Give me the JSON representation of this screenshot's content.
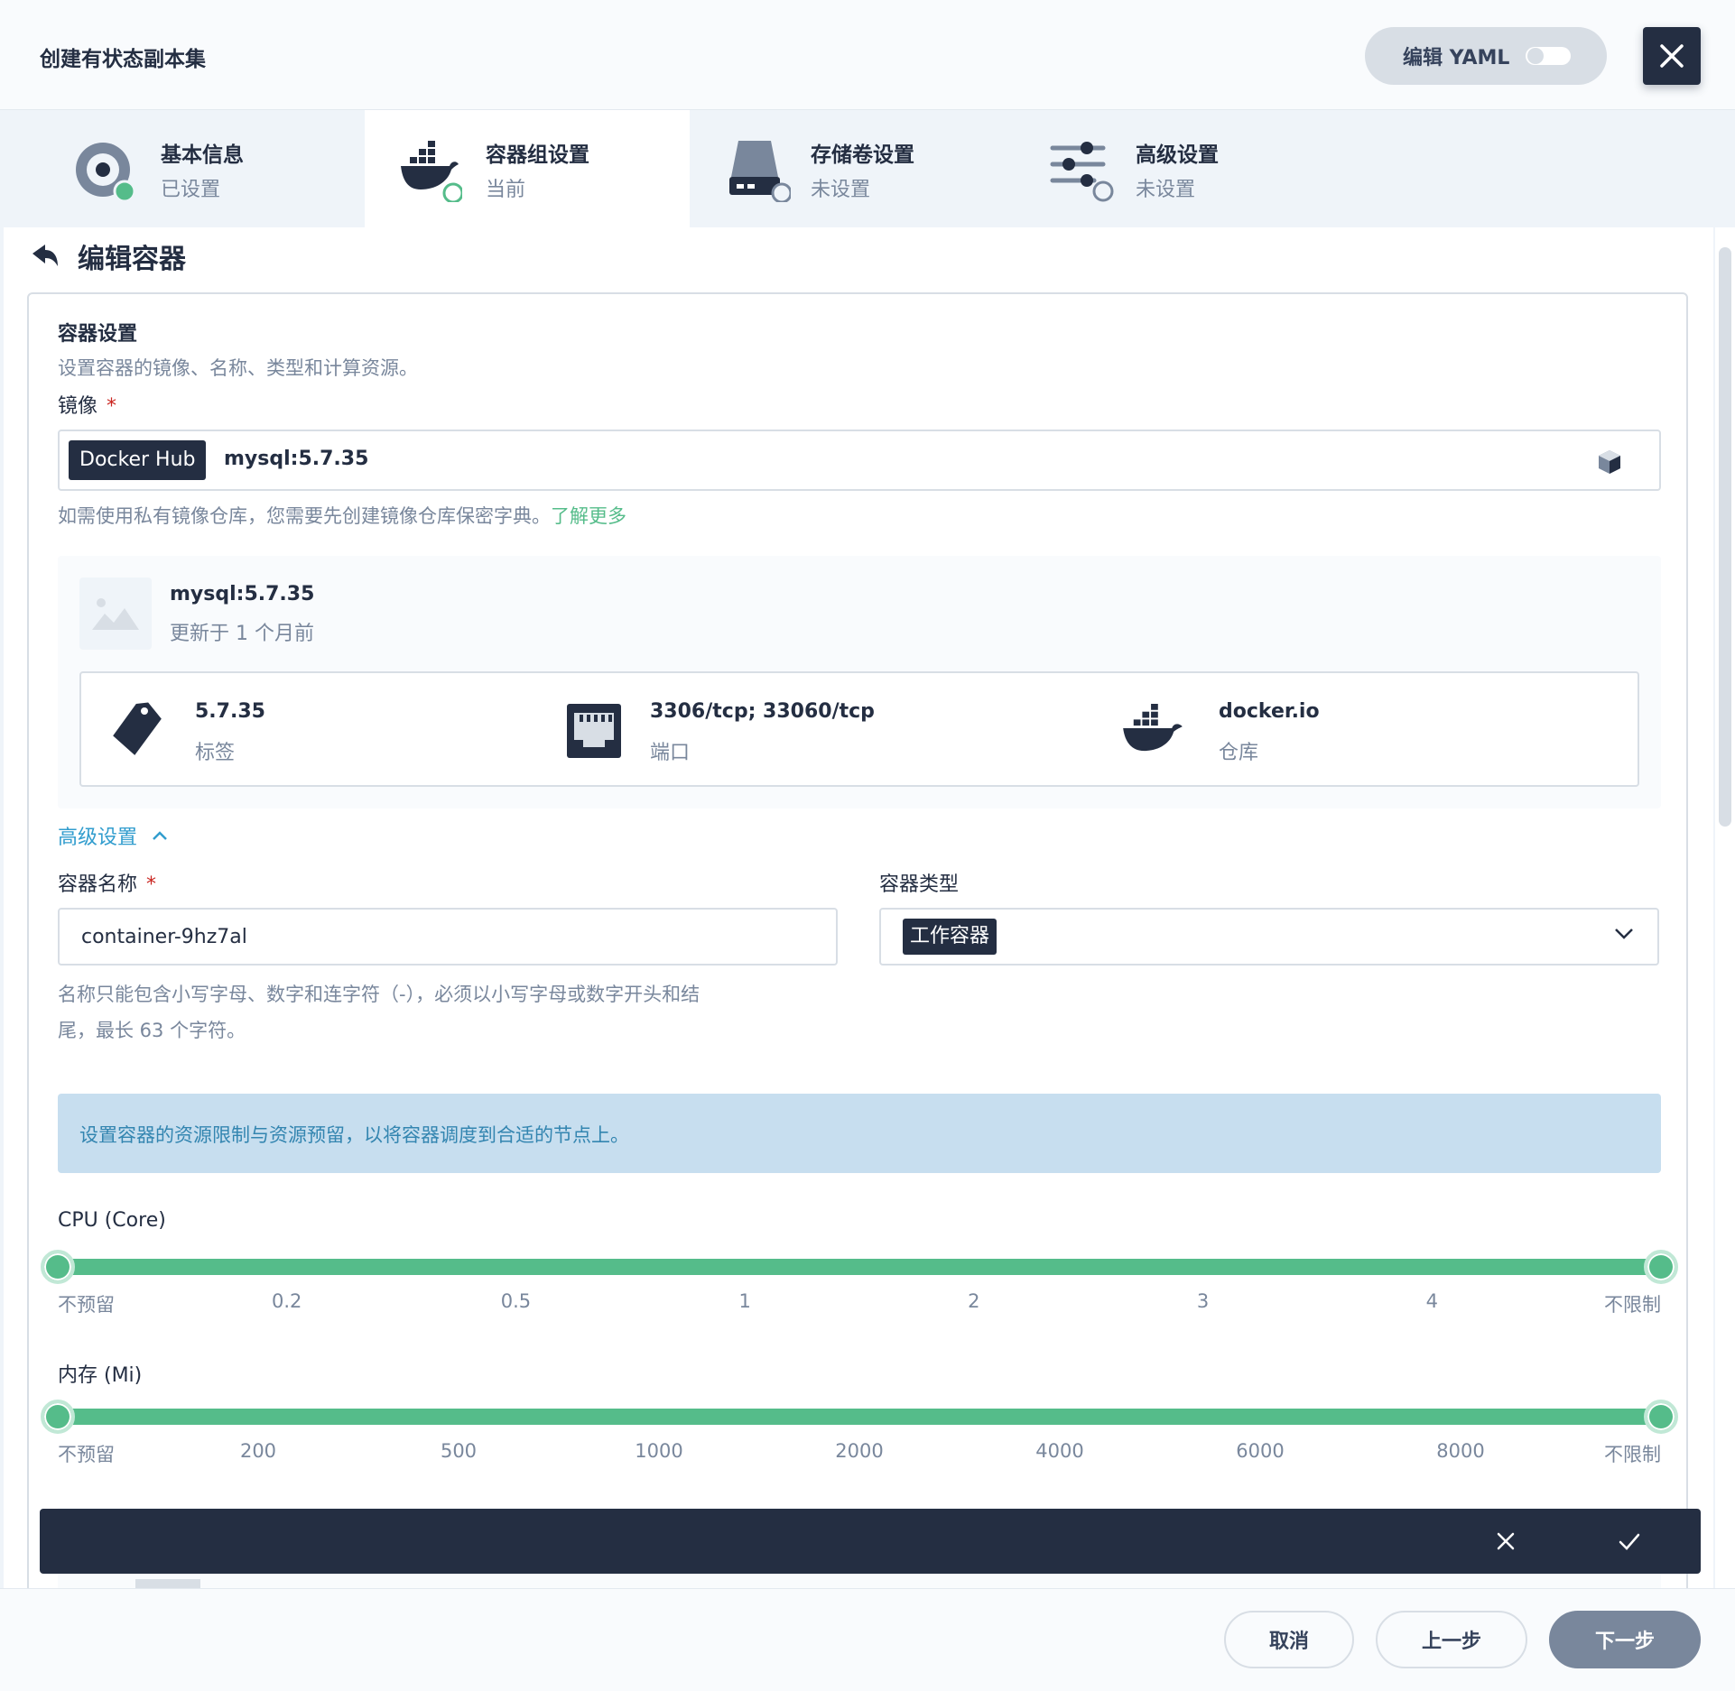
{
  "header": {
    "title": "创建有状态副本集",
    "yaml_label": "编辑 YAML"
  },
  "steps": [
    {
      "label": "基本信息",
      "status": "已设置"
    },
    {
      "label": "容器组设置",
      "status": "当前"
    },
    {
      "label": "存储卷设置",
      "status": "未设置"
    },
    {
      "label": "高级设置",
      "status": "未设置"
    }
  ],
  "editor": {
    "back_title": "编辑容器",
    "section_title": "容器设置",
    "section_desc": "设置容器的镜像、名称、类型和计算资源。",
    "image_label": "镜像",
    "required_mark": "*",
    "registry": "Docker Hub",
    "image_value": "mysql:5.7.35",
    "image_hint": "如需使用私有镜像仓库，您需要先创建镜像仓库保密字典。",
    "learn_more": "了解更多",
    "image_card": {
      "name": "mysql:5.7.35",
      "updated": "更新于 1 个月前",
      "tag_value": "5.7.35",
      "tag_label": "标签",
      "ports_value": "3306/tcp; 33060/tcp",
      "ports_label": "端口",
      "registry_value": "docker.io",
      "registry_label": "仓库"
    },
    "advanced_toggle": "高级设置",
    "name_label": "容器名称",
    "name_value": "container-9hz7al",
    "name_hint_1": "名称只能包含小写字母、数字和连字符（-），必须以小写字母或数字开头和结",
    "name_hint_2": "尾，最长 63 个字符。",
    "type_label": "容器类型",
    "type_value": "工作容器",
    "resource_info": "设置容器的资源限制与资源预留，以将容器调度到合适的节点上。",
    "cpu": {
      "label": "CPU (Core)",
      "ticks": [
        "不预留",
        "0.2",
        "0.5",
        "1",
        "2",
        "3",
        "4",
        "不限制"
      ],
      "low_fraction": 0,
      "high_fraction": 1
    },
    "memory": {
      "label": "内存 (Mi)",
      "ticks": [
        "不预留",
        "200",
        "500",
        "1000",
        "2000",
        "4000",
        "6000",
        "8000",
        "不限制"
      ],
      "low_fraction": 0,
      "high_fraction": 1
    }
  },
  "footer": {
    "cancel": "取消",
    "prev": "上一步",
    "next": "下一步"
  },
  "colors": {
    "accent": "#55bc8a",
    "dark": "#242e42",
    "link_blue": "#329dce",
    "info_bg": "#c7deef"
  }
}
